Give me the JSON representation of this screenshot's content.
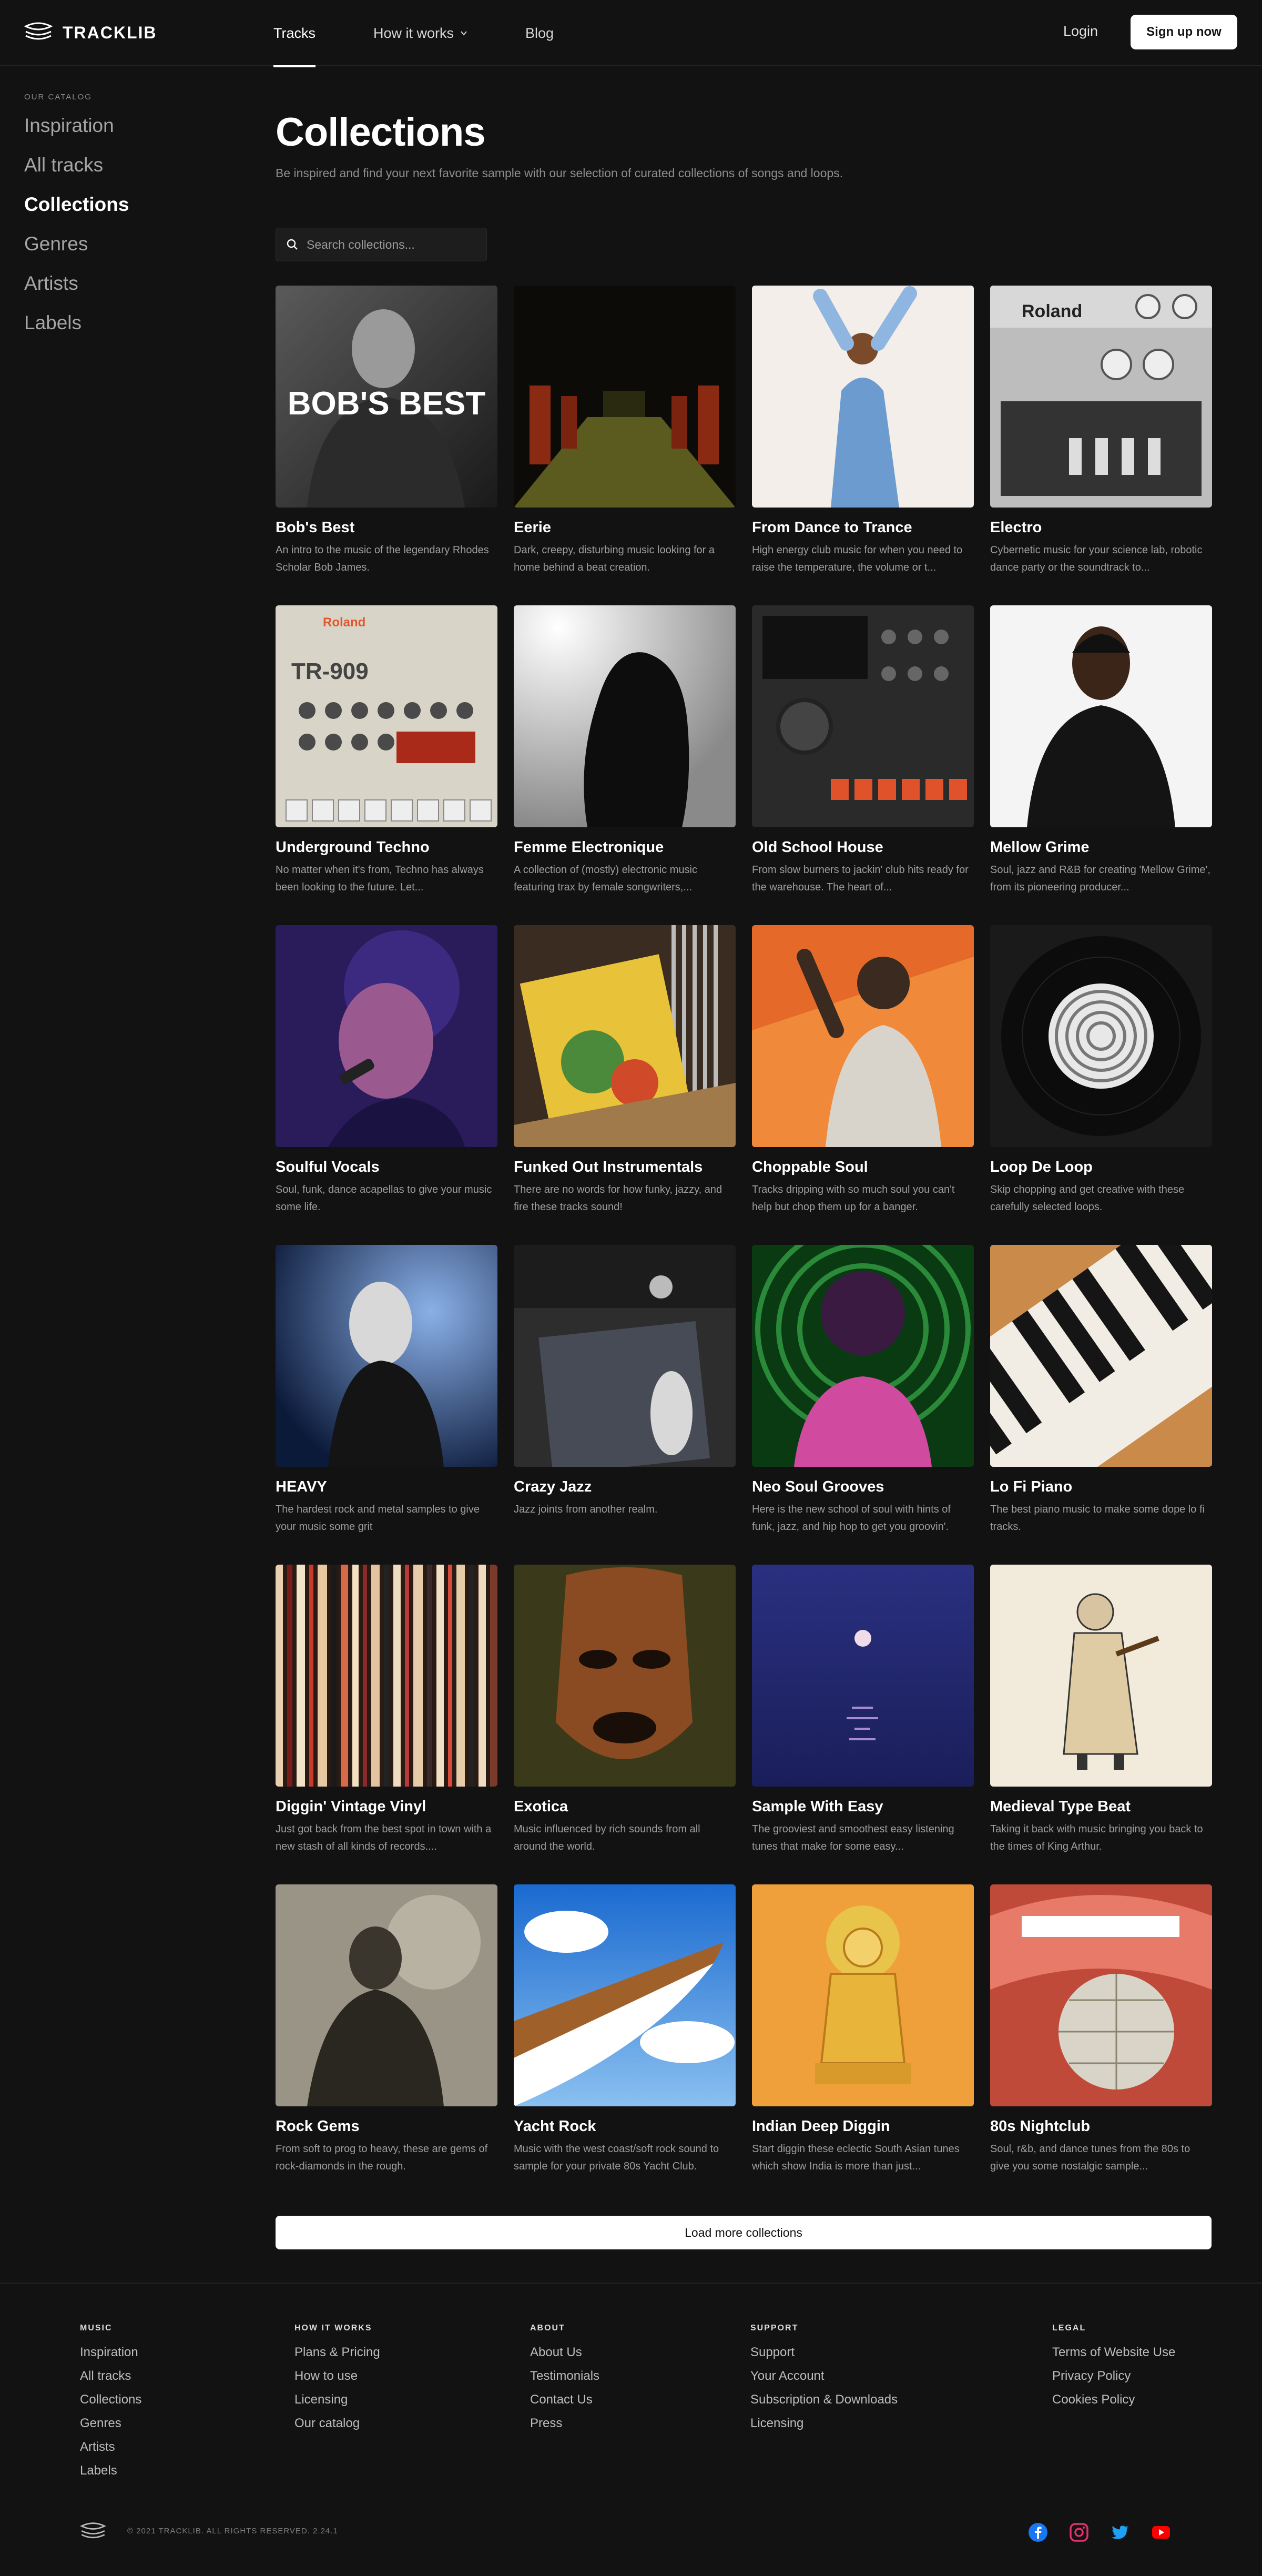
{
  "header": {
    "logo_text": "TRACKLIB",
    "nav": [
      {
        "label": "Tracks"
      },
      {
        "label": "How it works"
      },
      {
        "label": "Blog"
      }
    ],
    "login": "Login",
    "signup": "Sign up now"
  },
  "sidebar": {
    "heading": "OUR CATALOG",
    "items": [
      "Inspiration",
      "All tracks",
      "Collections",
      "Genres",
      "Artists",
      "Labels"
    ],
    "active": "Collections"
  },
  "main": {
    "title": "Collections",
    "subtitle": "Be inspired and find your next favorite sample with our selection of curated collections of songs and loops.",
    "search_placeholder": "Search collections...",
    "load_more": "Load more collections",
    "collections": [
      {
        "title": "Bob's Best",
        "desc": "An intro to the music of the legendary Rhodes Scholar Bob James.",
        "thumb_text": "BOB'S BEST"
      },
      {
        "title": "Eerie",
        "desc": "Dark, creepy, disturbing music looking for a home behind a beat creation."
      },
      {
        "title": "From Dance to Trance",
        "desc": "High energy club music for when you need to raise the temperature, the volume or t..."
      },
      {
        "title": "Electro",
        "desc": "Cybernetic music for your science lab, robotic dance party or the soundtrack to...",
        "thumb_text": "Roland"
      },
      {
        "title": "Underground Techno",
        "desc": "No matter when it's from, Techno has always been looking to the future. Let...",
        "thumb_text": "Roland",
        "thumb_text2": "TR-909"
      },
      {
        "title": "Femme Electronique",
        "desc": "A collection of (mostly) electronic music featuring trax by female songwriters,..."
      },
      {
        "title": "Old School House",
        "desc": "From slow burners to jackin' club hits ready for the warehouse. The heart of..."
      },
      {
        "title": "Mellow Grime",
        "desc": "Soul, jazz and R&B for creating 'Mellow Grime', from its pioneering producer..."
      },
      {
        "title": "Soulful Vocals",
        "desc": "Soul, funk, dance acapellas to give your music some life."
      },
      {
        "title": "Funked Out Instrumentals",
        "desc": "There are no words for how funky, jazzy, and fire these tracks sound!"
      },
      {
        "title": "Choppable Soul",
        "desc": "Tracks dripping with so much soul you can't help but chop them up for a banger."
      },
      {
        "title": "Loop De Loop",
        "desc": "Skip chopping and get creative with these carefully selected loops."
      },
      {
        "title": "HEAVY",
        "desc": "The hardest rock and metal samples to give your music some grit"
      },
      {
        "title": "Crazy Jazz",
        "desc": "Jazz joints from another realm."
      },
      {
        "title": "Neo Soul Grooves",
        "desc": "Here is the new school of soul with hints of funk, jazz, and hip hop to get you groovin'."
      },
      {
        "title": "Lo Fi Piano",
        "desc": "The best piano music to make some dope lo fi tracks."
      },
      {
        "title": "Diggin' Vintage Vinyl",
        "desc": "Just got back from the best spot in town with a new stash of all kinds of records...."
      },
      {
        "title": "Exotica",
        "desc": "Music influenced by rich sounds from all around the world."
      },
      {
        "title": "Sample With Easy",
        "desc": "The grooviest and smoothest easy listening tunes that make for some easy..."
      },
      {
        "title": "Medieval Type Beat",
        "desc": "Taking it back with music bringing you back to the times of King Arthur."
      },
      {
        "title": "Rock Gems",
        "desc": "From soft to prog to heavy, these are gems of rock-diamonds in the rough."
      },
      {
        "title": "Yacht Rock",
        "desc": "Music with the west coast/soft rock sound to sample for your private 80s Yacht Club."
      },
      {
        "title": "Indian Deep Diggin",
        "desc": "Start diggin these eclectic South Asian tunes which show India is more than just..."
      },
      {
        "title": "80s Nightclub",
        "desc": "Soul, r&b, and dance tunes from the 80s to give you some nostalgic sample..."
      }
    ]
  },
  "footer": {
    "columns": [
      {
        "heading": "MUSIC",
        "links": [
          "Inspiration",
          "All tracks",
          "Collections",
          "Genres",
          "Artists",
          "Labels"
        ]
      },
      {
        "heading": "HOW IT WORKS",
        "links": [
          "Plans & Pricing",
          "How to use",
          "Licensing",
          "Our catalog"
        ]
      },
      {
        "heading": "ABOUT",
        "links": [
          "About Us",
          "Testimonials",
          "Contact Us",
          "Press"
        ]
      },
      {
        "heading": "SUPPORT",
        "links": [
          "Support",
          "Your Account",
          "Subscription & Downloads",
          "Licensing"
        ]
      },
      {
        "heading": "LEGAL",
        "links": [
          "Terms of Website Use",
          "Privacy Policy",
          "Cookies Policy"
        ]
      }
    ],
    "copyright": "© 2021 TRACKLIB. ALL RIGHTS RESERVED. 2.24.1",
    "socials": [
      "facebook-icon",
      "instagram-icon",
      "twitter-icon",
      "youtube-icon"
    ]
  },
  "colors": {
    "background": "#121212",
    "facebook": "#1877f2",
    "instagram": "#e1306c",
    "twitter": "#1da1f2",
    "youtube": "#ff0000"
  }
}
